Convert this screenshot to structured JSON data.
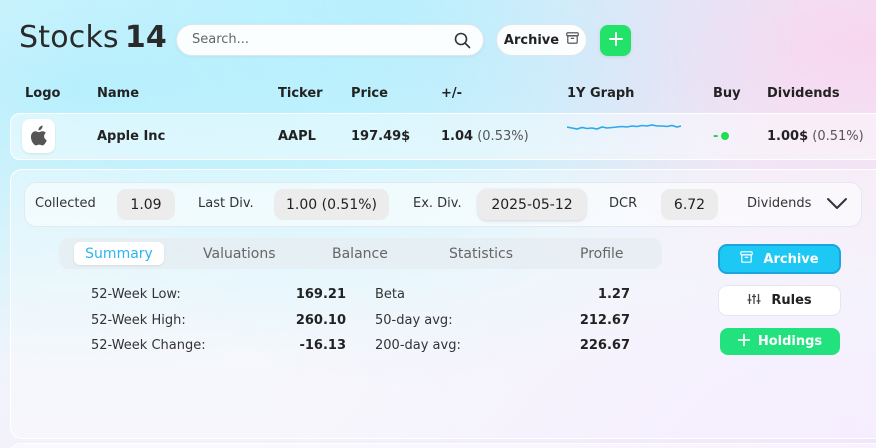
{
  "header": {
    "title": "Stocks",
    "count": "14",
    "search_placeholder": "Search...",
    "archive_label": "Archive"
  },
  "columns": {
    "logo": "Logo",
    "name": "Name",
    "ticker": "Ticker",
    "price": "Price",
    "change": "+/-",
    "graph": "1Y Graph",
    "buy": "Buy",
    "dividends": "Dividends"
  },
  "stock": {
    "name": "Apple Inc",
    "ticker": "AAPL",
    "price": "197.49$",
    "change": "1.04",
    "change_pct": "(0.53%)",
    "buy_indicator": "-",
    "dividend": "1.00$",
    "dividend_pct": "(0.51%)",
    "logo_icon": "apple-logo-icon",
    "sparkline_color": "#2aa8f0",
    "buy_dot_color": "#22dd55"
  },
  "dividend_bar": {
    "collected_label": "Collected",
    "collected_value": "1.09",
    "last_div_label": "Last Div.",
    "last_div_value": "1.00 (0.51%)",
    "ex_div_label": "Ex. Div.",
    "ex_div_value": "2025-05-12",
    "dcr_label": "DCR",
    "dcr_value": "6.72",
    "dropdown_label": "Dividends"
  },
  "tabs": [
    "Summary",
    "Valuations",
    "Balance",
    "Statistics",
    "Profile"
  ],
  "active_tab": "Summary",
  "summary": {
    "left": [
      {
        "label": "52-Week Low:",
        "value": "169.21"
      },
      {
        "label": "52-Week High:",
        "value": "260.10"
      },
      {
        "label": "52-Week Change:",
        "value": "-16.13"
      }
    ],
    "right": [
      {
        "label": "Beta",
        "value": "1.27"
      },
      {
        "label": "50-day avg:",
        "value": "212.67"
      },
      {
        "label": "200-day avg:",
        "value": "226.67"
      }
    ]
  },
  "actions": {
    "archive": "Archive",
    "rules": "Rules",
    "holdings": "Holdings"
  },
  "colors": {
    "accent_blue": "#1ec8f5",
    "accent_green": "#22e27d"
  }
}
